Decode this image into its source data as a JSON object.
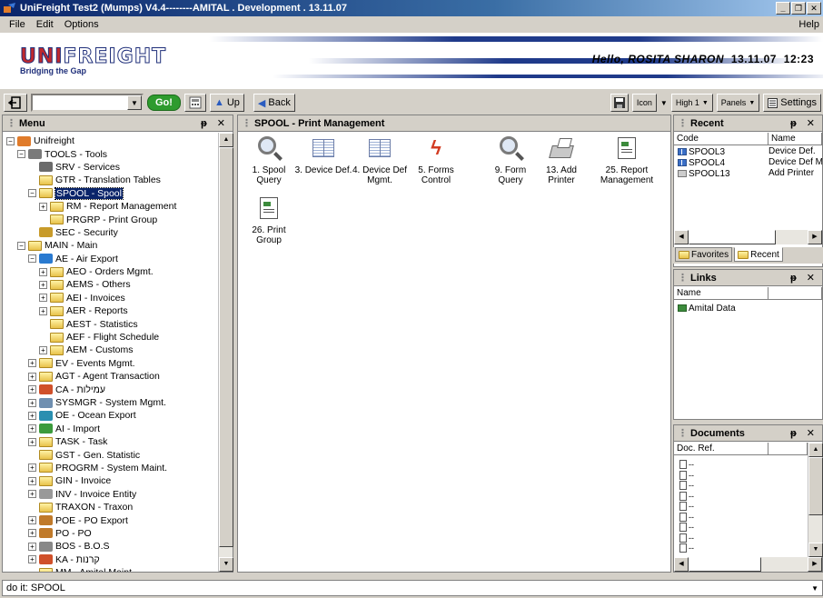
{
  "window": {
    "title": "UniFreight Test2 (Mumps) V4.4--------AMITAL . Development . 13.11.07",
    "minimize": "_",
    "restore": "❐",
    "close": "✕"
  },
  "menubar": {
    "items": [
      "File",
      "Edit",
      "Options"
    ],
    "help": "Help"
  },
  "banner": {
    "logo_word_a": "UNI",
    "logo_word_b": "FREIGHT",
    "tagline": "Bridging the Gap",
    "greeting": "Hello, ROSITA SHARON",
    "date": "13.11.07",
    "time": "12:23"
  },
  "toolbar": {
    "command_value": "",
    "go_label": "Go!",
    "up_label": "Up",
    "back_label": "Back",
    "icon_label": "Icon",
    "high_label": "High 1",
    "panels_label": "Panels",
    "settings_label": "Settings"
  },
  "menu_panel": {
    "title": "Menu",
    "controls": "ᵽ ✕",
    "tree": [
      {
        "label": "Unifreight",
        "level": 0,
        "exp": "−",
        "icon": "app"
      },
      {
        "label": "TOOLS - Tools",
        "level": 1,
        "exp": "−",
        "icon": "tools"
      },
      {
        "label": "SRV - Services",
        "level": 2,
        "exp": "",
        "icon": "gear"
      },
      {
        "label": "GTR - Translation Tables",
        "level": 2,
        "exp": "",
        "icon": "folder"
      },
      {
        "label": "SPOOL - Spool",
        "level": 2,
        "exp": "−",
        "icon": "folder",
        "selected": true
      },
      {
        "label": "RM - Report Management",
        "level": 3,
        "exp": "+",
        "icon": "folder"
      },
      {
        "label": "PRGRP - Print Group",
        "level": 3,
        "exp": "",
        "icon": "folder"
      },
      {
        "label": "SEC - Security",
        "level": 2,
        "exp": "",
        "icon": "key"
      },
      {
        "label": "MAIN - Main",
        "level": 1,
        "exp": "−",
        "icon": "folder"
      },
      {
        "label": "AE - Air Export",
        "level": 2,
        "exp": "−",
        "icon": "plane"
      },
      {
        "label": "AEO - Orders Mgmt.",
        "level": 3,
        "exp": "+",
        "icon": "folder"
      },
      {
        "label": "AEMS - Others",
        "level": 3,
        "exp": "+",
        "icon": "folder"
      },
      {
        "label": "AEI - Invoices",
        "level": 3,
        "exp": "+",
        "icon": "folder"
      },
      {
        "label": "AER - Reports",
        "level": 3,
        "exp": "+",
        "icon": "folder"
      },
      {
        "label": "AEST - Statistics",
        "level": 3,
        "exp": "",
        "icon": "folder"
      },
      {
        "label": "AEF - Flight Schedule",
        "level": 3,
        "exp": "",
        "icon": "folder"
      },
      {
        "label": "AEM - Customs",
        "level": 3,
        "exp": "+",
        "icon": "folder"
      },
      {
        "label": "EV - Events Mgmt.",
        "level": 2,
        "exp": "+",
        "icon": "folder"
      },
      {
        "label": "AGT - Agent Transaction",
        "level": 2,
        "exp": "+",
        "icon": "folder"
      },
      {
        "label": "CA - עמילות",
        "level": 2,
        "exp": "+",
        "icon": "chart"
      },
      {
        "label": "SYSMGR - System Mgmt.",
        "level": 2,
        "exp": "+",
        "icon": "monitor"
      },
      {
        "label": "OE - Ocean Export",
        "level": 2,
        "exp": "+",
        "icon": "ship"
      },
      {
        "label": "AI - Import",
        "level": 2,
        "exp": "+",
        "icon": "globe"
      },
      {
        "label": "TASK - Task",
        "level": 2,
        "exp": "+",
        "icon": "folder"
      },
      {
        "label": "GST - Gen. Statistic",
        "level": 2,
        "exp": "",
        "icon": "folder"
      },
      {
        "label": "PROGRM - System Maint.",
        "level": 2,
        "exp": "+",
        "icon": "folder"
      },
      {
        "label": "GIN - Invoice",
        "level": 2,
        "exp": "+",
        "icon": "folder"
      },
      {
        "label": "INV - Invoice Entity",
        "level": 2,
        "exp": "+",
        "icon": "doc"
      },
      {
        "label": "TRAXON - Traxon",
        "level": 2,
        "exp": "",
        "icon": "folder"
      },
      {
        "label": "POE - PO Export",
        "level": 2,
        "exp": "+",
        "icon": "people"
      },
      {
        "label": "PO - PO",
        "level": 2,
        "exp": "+",
        "icon": "people"
      },
      {
        "label": "BOS - B.O.S",
        "level": 2,
        "exp": "+",
        "icon": "stack"
      },
      {
        "label": "KA - קרנות",
        "level": 2,
        "exp": "+",
        "icon": "chart"
      },
      {
        "label": "MM - Amital Maint.",
        "level": 2,
        "exp": "",
        "icon": "folder"
      }
    ]
  },
  "spool_panel": {
    "title": "SPOOL - Print Management",
    "items": [
      {
        "label": "1. Spool Query",
        "icon": "magnifier"
      },
      {
        "label": "3. Device Def.",
        "icon": "book"
      },
      {
        "label": "4. Device Def Mgmt.",
        "icon": "book"
      },
      {
        "label": "5. Forms Control",
        "icon": "bolt"
      },
      {
        "label": "9. Form Query",
        "icon": "magnifier"
      },
      {
        "label": "13. Add Printer",
        "icon": "printer"
      },
      {
        "label": "25. Report Management",
        "icon": "report"
      },
      {
        "label": "26. Print Group",
        "icon": "report"
      }
    ]
  },
  "recent_panel": {
    "title": "Recent",
    "controls": "ᵽ ✕",
    "columns": [
      "Code",
      "Name"
    ],
    "rows": [
      {
        "code": "SPOOL3",
        "name": "Device Def."
      },
      {
        "code": "SPOOL4",
        "name": "Device Def M"
      },
      {
        "code": "SPOOL13",
        "name": "Add Printer"
      }
    ],
    "tabs": [
      "Favorites",
      "Recent"
    ]
  },
  "links_panel": {
    "title": "Links",
    "controls": "ᵽ ✕",
    "columns": [
      "Name"
    ],
    "rows": [
      "Amital Data"
    ]
  },
  "docs_panel": {
    "title": "Documents",
    "controls": "ᵽ ✕",
    "columns": [
      "Doc. Ref."
    ],
    "rows": [
      "--",
      "--",
      "--",
      "--",
      "--",
      "--",
      "--",
      "--",
      "--"
    ]
  },
  "statusbar": {
    "text": "do it: SPOOL"
  }
}
